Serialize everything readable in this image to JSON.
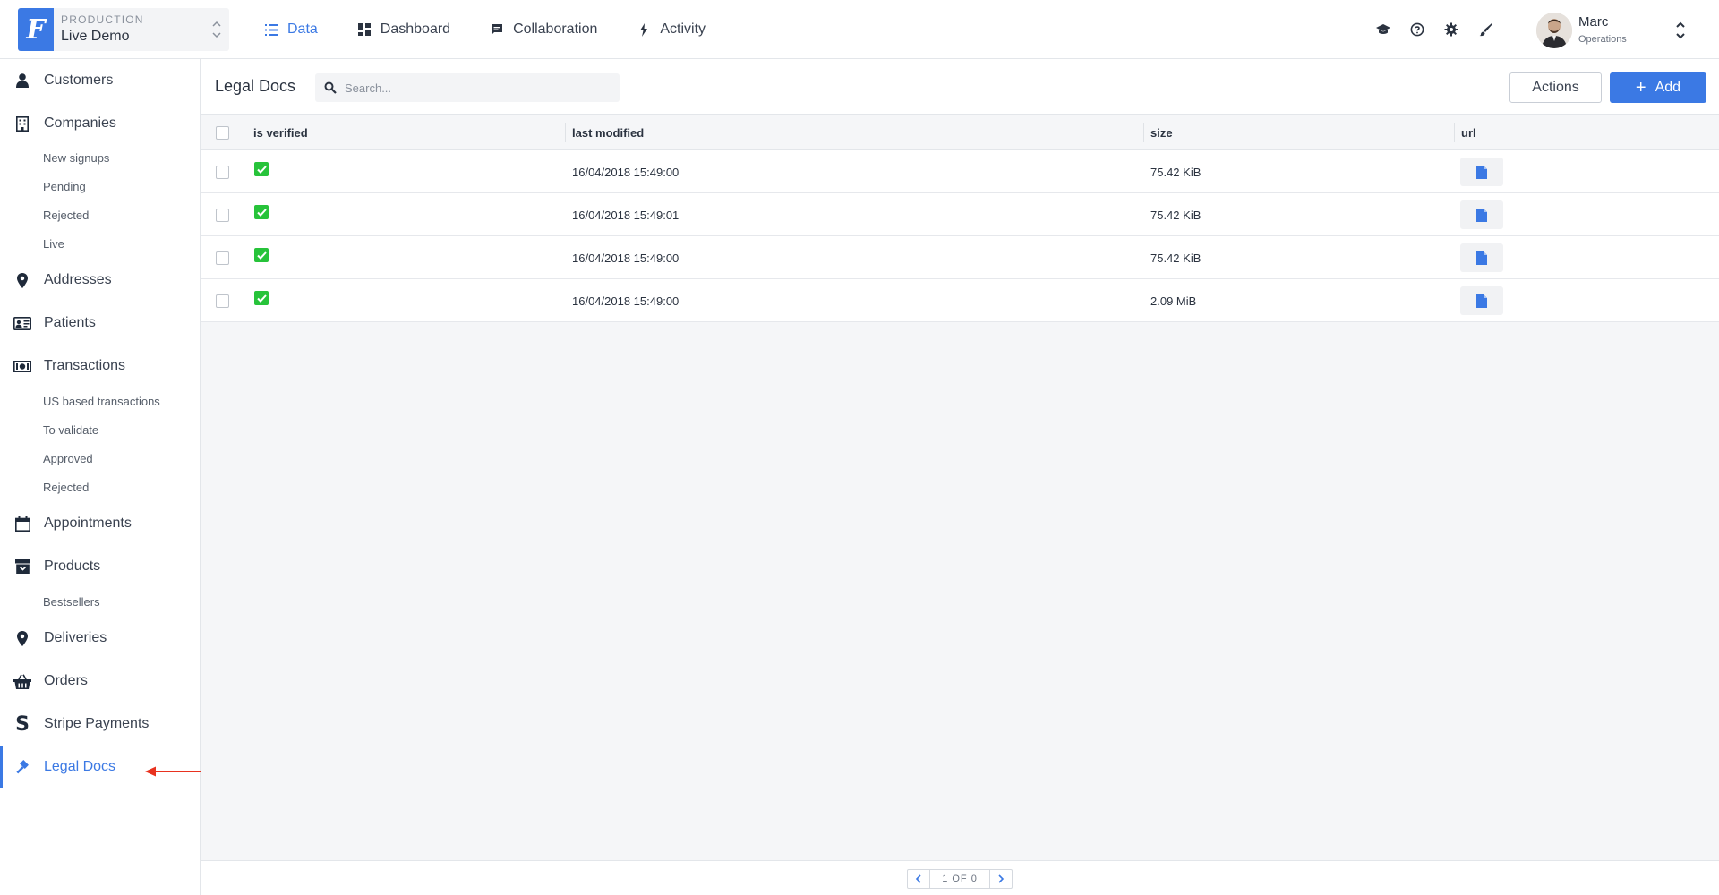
{
  "project": {
    "env": "PRODUCTION",
    "name": "Live Demo",
    "logo_letter": "F"
  },
  "main_nav": [
    {
      "label": "Data",
      "icon": "list-icon",
      "active": true
    },
    {
      "label": "Dashboard",
      "icon": "dashboard-icon",
      "active": false
    },
    {
      "label": "Collaboration",
      "icon": "chat-icon",
      "active": false
    },
    {
      "label": "Activity",
      "icon": "bolt-icon",
      "active": false
    }
  ],
  "top_icons": [
    "graduation-cap-icon",
    "help-icon",
    "gear-icon",
    "brush-icon"
  ],
  "user": {
    "name": "Marc",
    "role": "Operations"
  },
  "sidebar": {
    "items": [
      {
        "label": "Customers",
        "icon": "person-icon"
      },
      {
        "label": "Companies",
        "icon": "building-icon"
      },
      {
        "label": "Addresses",
        "icon": "map-pin-icon"
      },
      {
        "label": "Patients",
        "icon": "id-card-icon"
      },
      {
        "label": "Transactions",
        "icon": "money-icon"
      },
      {
        "label": "Appointments",
        "icon": "calendar-icon"
      },
      {
        "label": "Products",
        "icon": "archive-icon"
      },
      {
        "label": "Deliveries",
        "icon": "map-pin-icon"
      },
      {
        "label": "Orders",
        "icon": "basket-icon"
      },
      {
        "label": "Stripe Payments",
        "icon": "stripe-icon"
      },
      {
        "label": "Legal Docs",
        "icon": "gavel-icon",
        "active": true
      }
    ],
    "companies_sub": [
      "New signups",
      "Pending",
      "Rejected",
      "Live"
    ],
    "transactions_sub": [
      "US based transactions",
      "To validate",
      "Approved",
      "Rejected"
    ],
    "products_sub": [
      "Bestsellers"
    ]
  },
  "page": {
    "title": "Legal Docs",
    "search_placeholder": "Search...",
    "actions_label": "Actions",
    "add_label": "Add"
  },
  "table": {
    "columns": [
      "is verified",
      "last modified",
      "size",
      "url"
    ],
    "rows": [
      {
        "is_verified": true,
        "last_modified": "16/04/2018 15:49:00",
        "size": "75.42 KiB"
      },
      {
        "is_verified": true,
        "last_modified": "16/04/2018 15:49:01",
        "size": "75.42 KiB"
      },
      {
        "is_verified": true,
        "last_modified": "16/04/2018 15:49:00",
        "size": "75.42 KiB"
      },
      {
        "is_verified": true,
        "last_modified": "16/04/2018 15:49:00",
        "size": "2.09 MiB"
      }
    ]
  },
  "pager": {
    "label": "1 OF 0"
  },
  "colors": {
    "accent": "#3b79e4",
    "verified": "#27c33a",
    "annotation_arrow": "#e8321f"
  }
}
